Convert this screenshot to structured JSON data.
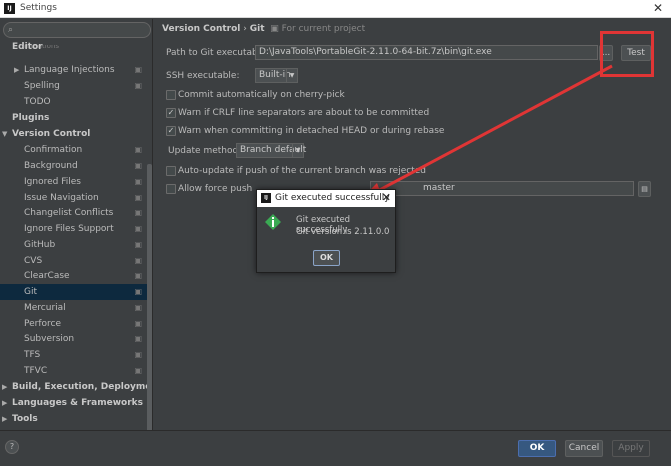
{
  "window": {
    "title": "Settings",
    "app_icon": "IJ"
  },
  "sidebar": {
    "search_placeholder": "",
    "items": [
      {
        "label": "Intentions",
        "indent": 2,
        "bold": false
      },
      {
        "label": "Editor",
        "indent": 0,
        "bold": true
      },
      {
        "label": "Language Injections",
        "indent": 1,
        "bold": false,
        "arrow": true,
        "proj": true
      },
      {
        "label": "Spelling",
        "indent": 1,
        "bold": false,
        "proj": true
      },
      {
        "label": "TODO",
        "indent": 1,
        "bold": false
      },
      {
        "label": "Plugins",
        "indent": 0,
        "bold": true
      },
      {
        "label": "Version Control",
        "indent": 0,
        "bold": true,
        "arrow": true,
        "open": true
      },
      {
        "label": "Confirmation",
        "indent": 1,
        "proj": true
      },
      {
        "label": "Background",
        "indent": 1,
        "proj": true
      },
      {
        "label": "Ignored Files",
        "indent": 1,
        "proj": true
      },
      {
        "label": "Issue Navigation",
        "indent": 1,
        "proj": true
      },
      {
        "label": "Changelist Conflicts",
        "indent": 1,
        "proj": true
      },
      {
        "label": "Ignore Files Support",
        "indent": 1,
        "proj": true
      },
      {
        "label": "GitHub",
        "indent": 1,
        "proj": true
      },
      {
        "label": "CVS",
        "indent": 1,
        "proj": true
      },
      {
        "label": "ClearCase",
        "indent": 1,
        "proj": true
      },
      {
        "label": "Git",
        "indent": 1,
        "proj": true,
        "selected": true
      },
      {
        "label": "Mercurial",
        "indent": 1,
        "proj": true
      },
      {
        "label": "Perforce",
        "indent": 1,
        "proj": true
      },
      {
        "label": "Subversion",
        "indent": 1,
        "proj": true
      },
      {
        "label": "TFS",
        "indent": 1,
        "proj": true
      },
      {
        "label": "TFVC",
        "indent": 1,
        "proj": true
      },
      {
        "label": "Build, Execution, Deployment",
        "indent": 0,
        "bold": true,
        "arrow": true
      },
      {
        "label": "Languages & Frameworks",
        "indent": 0,
        "bold": true,
        "arrow": true
      },
      {
        "label": "Tools",
        "indent": 0,
        "bold": true,
        "arrow": true
      }
    ]
  },
  "breadcrumb": {
    "parent": "Version Control",
    "sep": "›",
    "current": "Git",
    "note": "For current project"
  },
  "form": {
    "path_label": "Path to Git executable:",
    "path_value": "D:\\JavaTools\\PortableGit-2.11.0-64-bit.7z\\bin\\git.exe",
    "browse_label": "...",
    "test_label": "Test",
    "ssh_label": "SSH executable:",
    "ssh_value": "Built-in",
    "cherry_pick": {
      "label": "Commit automatically on cherry-pick",
      "checked": false
    },
    "crlf": {
      "label": "Warn if CRLF line separators are about to be committed",
      "checked": true
    },
    "detached": {
      "label": "Warn when committing in detached HEAD or during rebase",
      "checked": true
    },
    "update_label": "Update method:",
    "update_value": "Branch default",
    "auto_update": {
      "label": "Auto-update if push of the current branch was rejected",
      "checked": false
    },
    "force_push": {
      "label": "Allow force push",
      "checked": false
    },
    "protected_value": "master"
  },
  "dialog": {
    "title": "Git executed successfully",
    "line1": "Git executed successfully",
    "line2": "Git version is 2.11.0.0",
    "ok_label": "OK"
  },
  "footer": {
    "help": "?",
    "ok": "OK",
    "cancel": "Cancel",
    "apply": "Apply"
  },
  "colors": {
    "accent": "#365880",
    "annotation": "#e03535",
    "selected_row": "#0d293e",
    "info_icon": "#3aaa53"
  }
}
